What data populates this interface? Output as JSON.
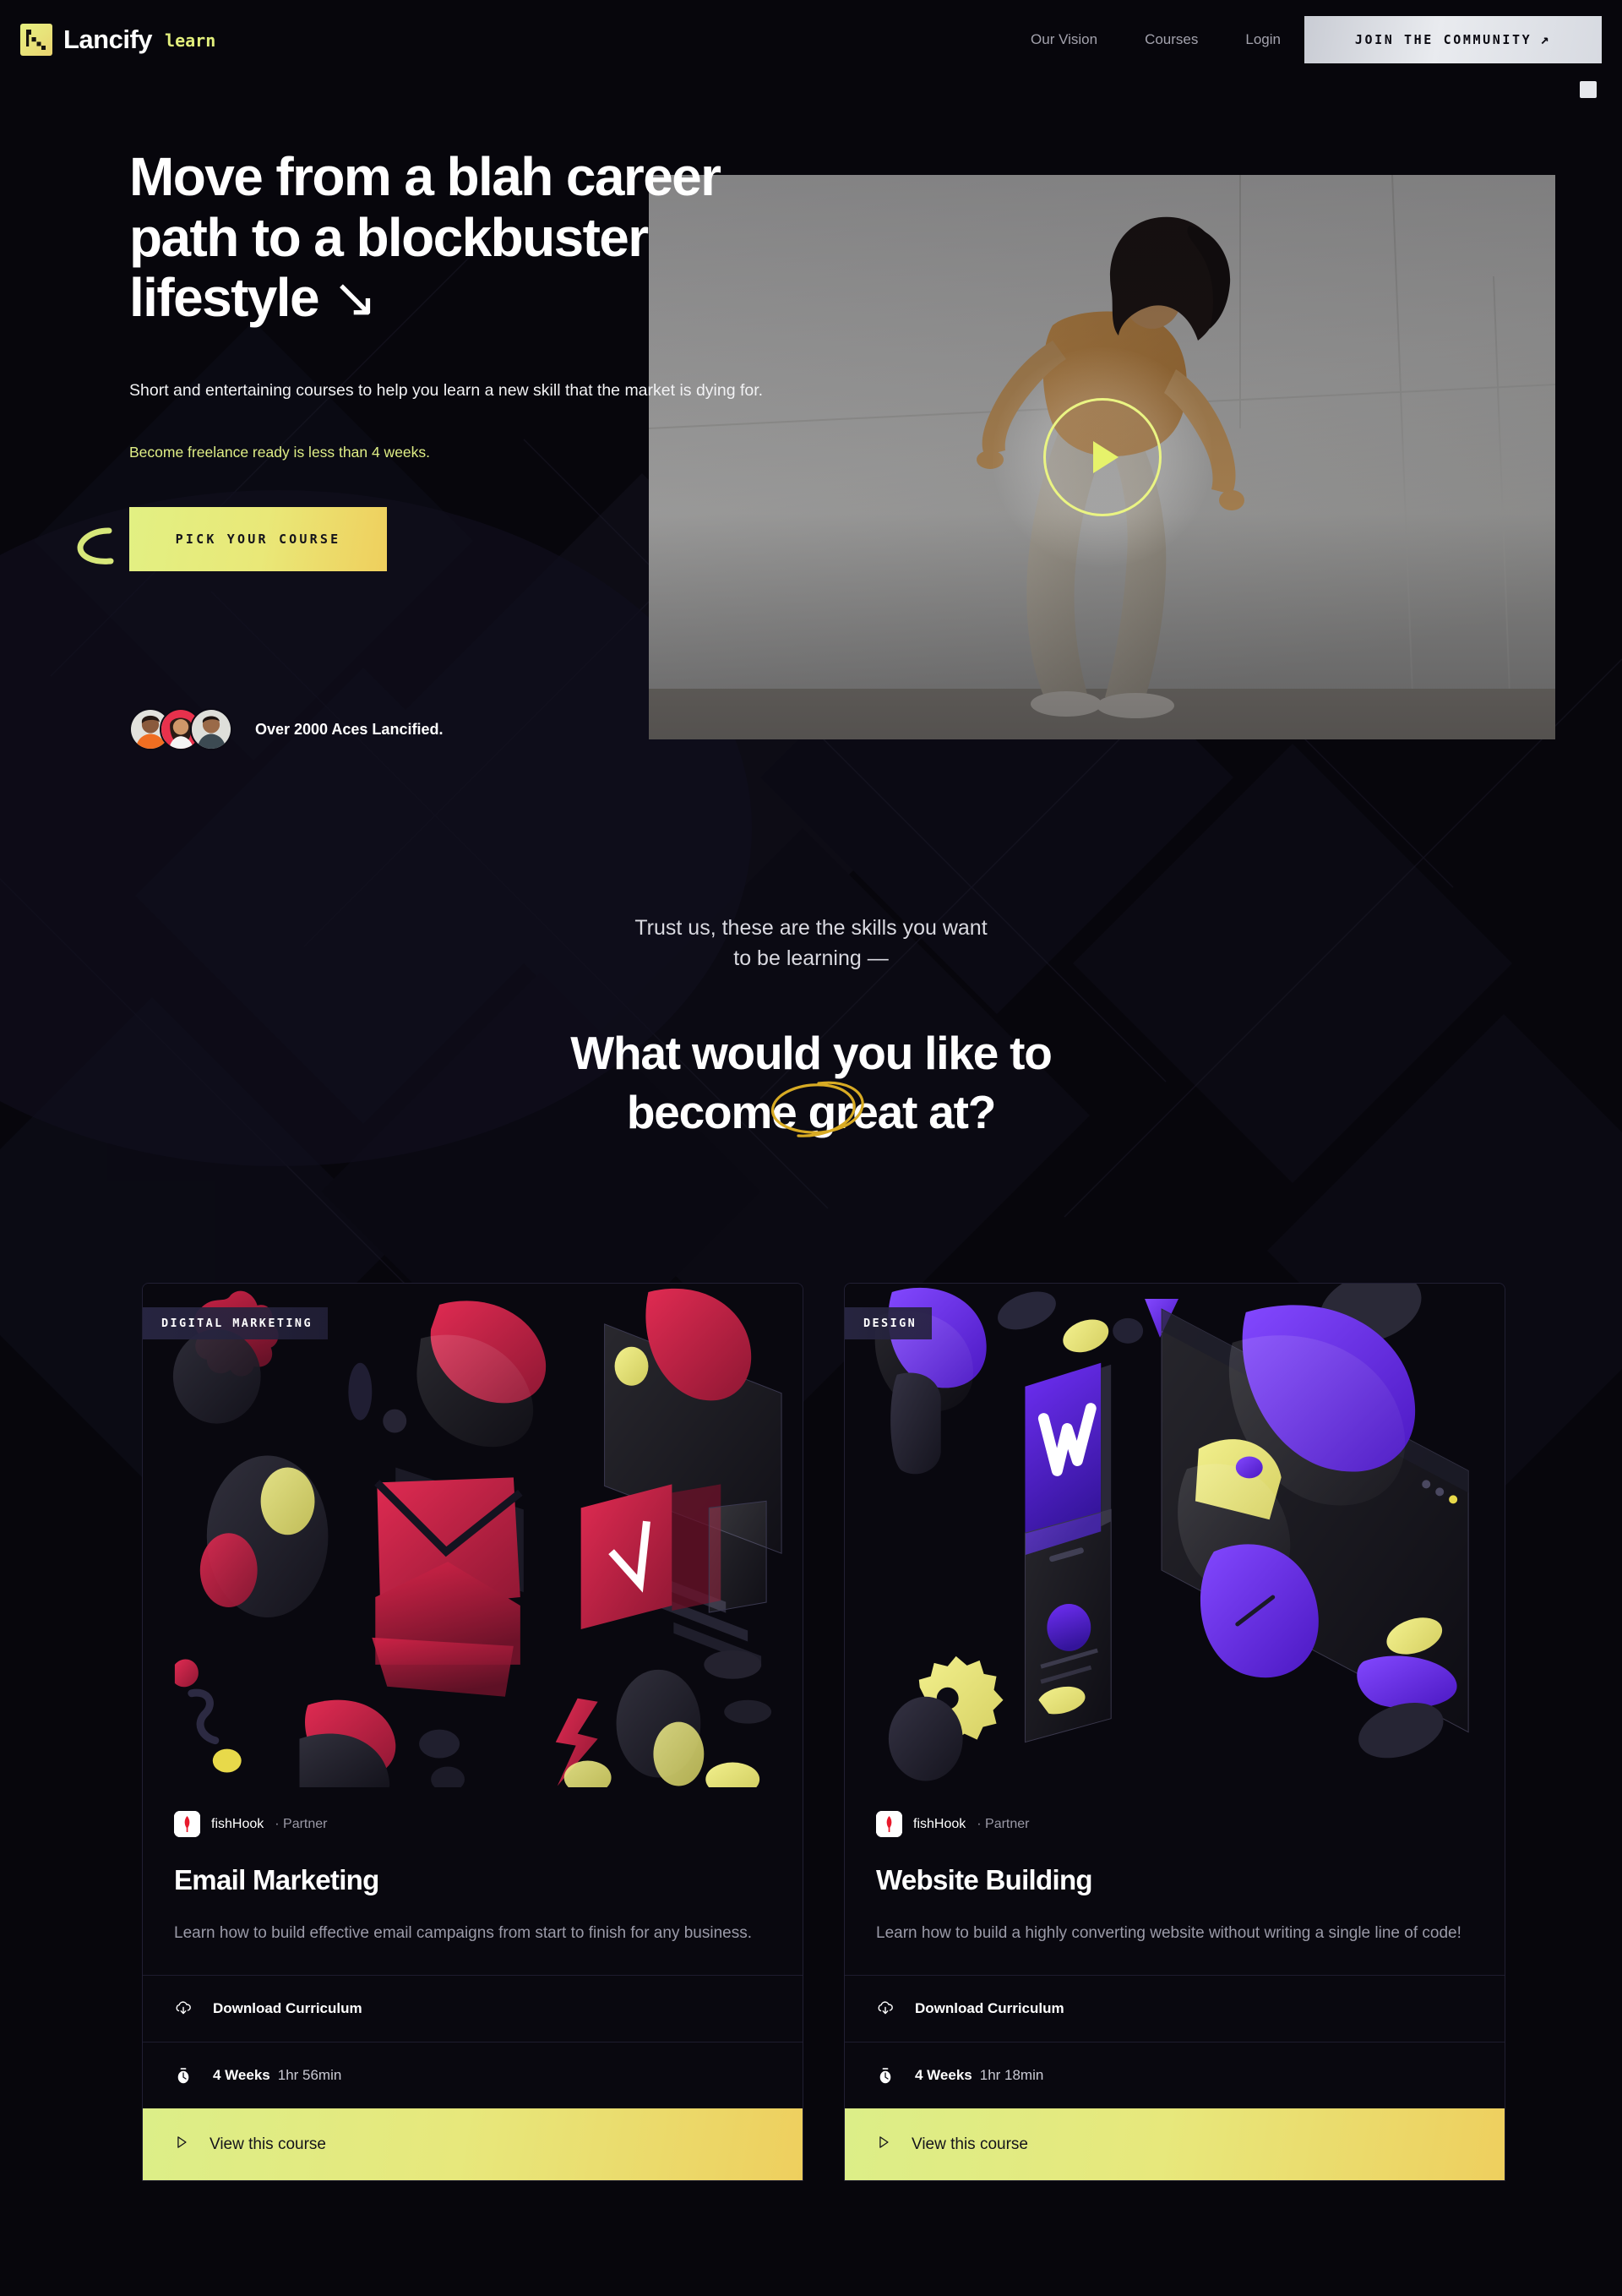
{
  "nav": {
    "logo_text": "Lancify",
    "logo_sub": "learn",
    "links": [
      {
        "label": "Our Vision"
      },
      {
        "label": "Courses"
      },
      {
        "label": "Login"
      }
    ],
    "cta_label": "JOIN THE COMMUNITY",
    "cta_arrow": "↗"
  },
  "hero": {
    "title_line1": "Move from a blah career",
    "title_line2": "path to a blockbuster",
    "title_line3": "lifestyle",
    "title_arrow": "↘",
    "subtitle": "Short and entertaining courses to help you learn a new skill that the market is dying for.",
    "accent": "Become freelance ready is less than 4 weeks.",
    "cta_label": "PICK YOUR COURSE",
    "social_proof": "Over 2000 Aces Lancified."
  },
  "mid": {
    "kicker_line1": "Trust us, these are the skills you want",
    "kicker_line2": "to be learning —",
    "heading_line1": "What would you like to",
    "heading_line2": "become great at?"
  },
  "cards": [
    {
      "badge": "DIGITAL MARKETING",
      "partner_name": "fishHook",
      "partner_role": "· Partner",
      "title": "Email Marketing",
      "description": "Learn how to build effective email campaigns from start to finish for any business.",
      "download_label": "Download Curriculum",
      "duration_weeks": "4 Weeks",
      "duration_time": "1hr 56min",
      "view_label": "View this course",
      "accent": "#d0254b"
    },
    {
      "badge": "DESIGN",
      "partner_name": "fishHook",
      "partner_role": "· Partner",
      "title": "Website Building",
      "description": "Learn how to build a highly converting website without writing a single line of code!",
      "download_label": "Download Curriculum",
      "duration_weeks": "4 Weeks",
      "duration_time": "1hr 18min",
      "view_label": "View this course",
      "accent": "#6a35e8"
    }
  ],
  "colors": {
    "background": "#07060c",
    "accent_yellow": "#e2ef7c",
    "cta_gradient_start": "#e2f083",
    "cta_gradient_end": "#efcf5d",
    "text_muted": "#9a9aa8"
  },
  "icons": {
    "download": "download-cloud-icon",
    "timer": "timer-icon",
    "play": "play-icon"
  }
}
